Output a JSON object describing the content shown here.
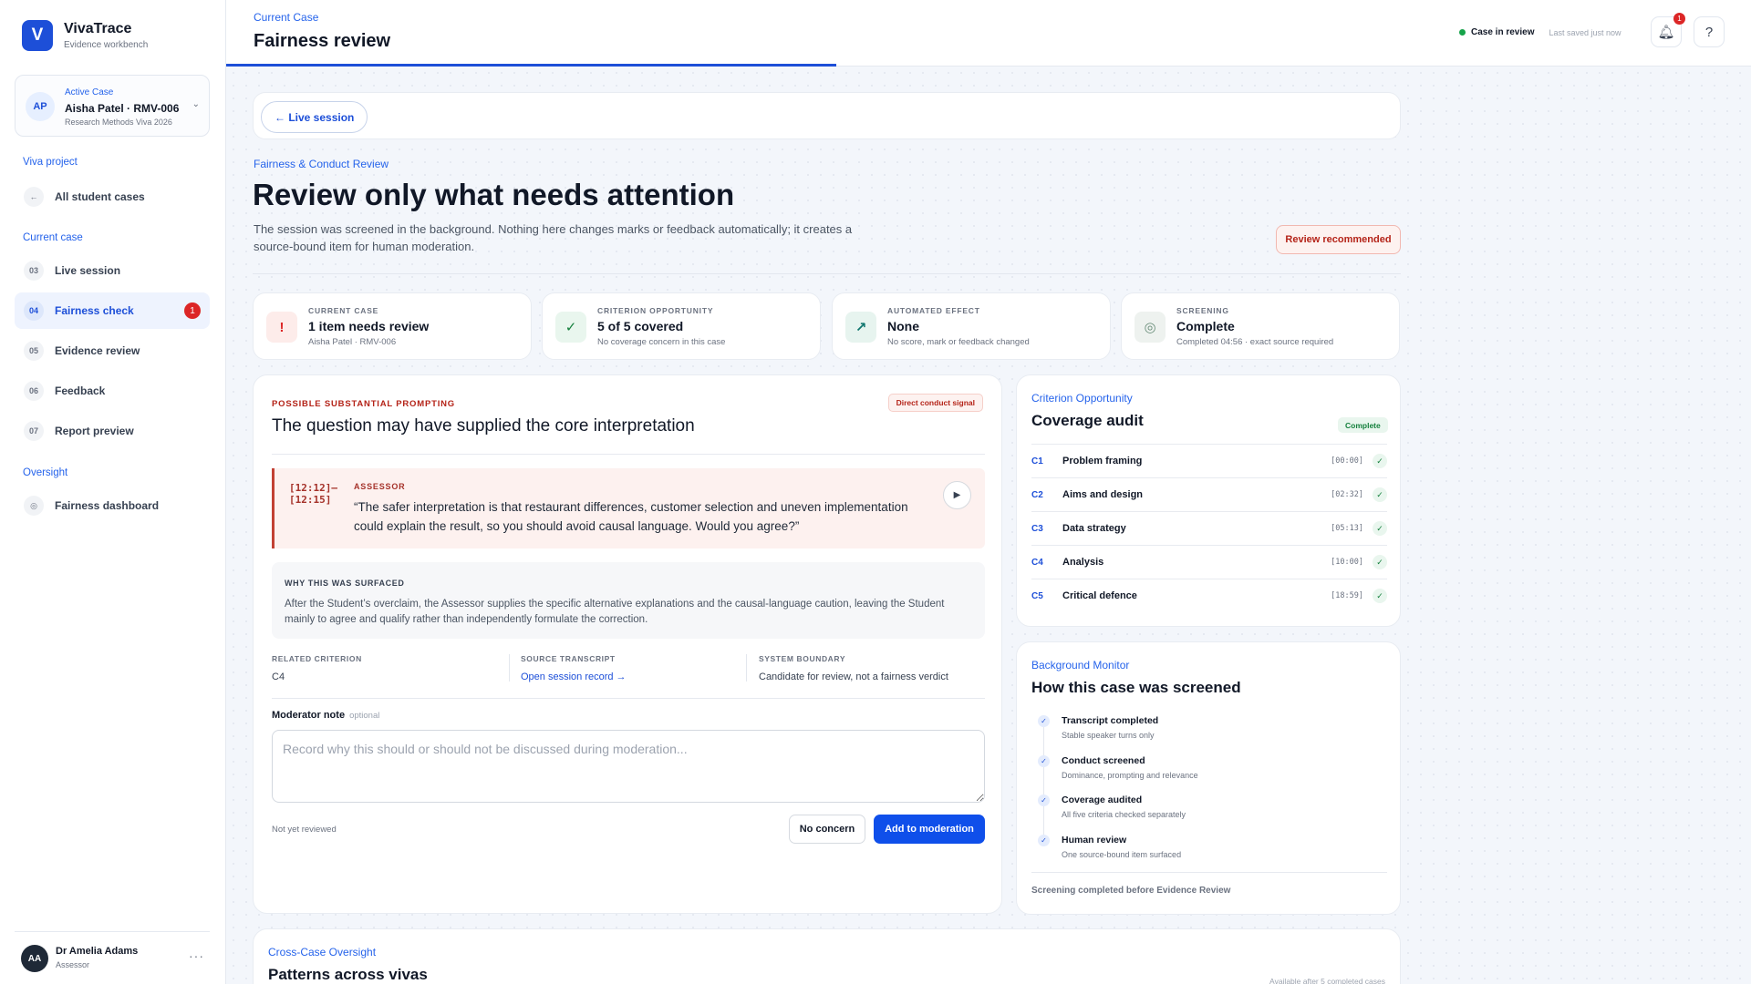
{
  "app": {
    "name": "VivaTrace",
    "subtitle": "Evidence workbench",
    "logo_letter": "V"
  },
  "active_case": {
    "label": "Active Case",
    "initials": "AP",
    "name": "Aisha Patel · RMV-006",
    "sub": "Research Methods Viva 2026"
  },
  "nav": {
    "project_label": "Viva project",
    "all_cases": "All student cases",
    "current_label": "Current case",
    "items": [
      {
        "num": "03",
        "label": "Live session"
      },
      {
        "num": "04",
        "label": "Fairness check",
        "badge": "1"
      },
      {
        "num": "05",
        "label": "Evidence review"
      },
      {
        "num": "06",
        "label": "Feedback"
      },
      {
        "num": "07",
        "label": "Report preview"
      }
    ],
    "oversight_label": "Oversight",
    "dashboard": "Fairness dashboard"
  },
  "user": {
    "initials": "AA",
    "name": "Dr Amelia Adams",
    "role": "Assessor"
  },
  "topbar": {
    "eyebrow": "Current Case",
    "title": "Fairness review",
    "status": "Case in review",
    "saved": "Last saved just now",
    "notif_count": "1",
    "progress": 0.4
  },
  "back_label": "← Live session",
  "page": {
    "eyebrow": "Fairness & Conduct Review",
    "title": "Review only what needs attention",
    "desc": "The session was screened in the background. Nothing here changes marks or feedback automatically; it creates a source-bound item for human moderation.",
    "pill": "Review recommended"
  },
  "stats": [
    {
      "label": "Current Case",
      "value": "1 item needs review",
      "sub": "Aisha Patel · RMV-006",
      "icon": "!"
    },
    {
      "label": "Criterion Opportunity",
      "value": "5 of 5 covered",
      "sub": "No coverage concern in this case",
      "icon": "✓"
    },
    {
      "label": "Automated Effect",
      "value": "None",
      "sub": "No score, mark or feedback changed",
      "icon": "↗"
    },
    {
      "label": "Screening",
      "value": "Complete",
      "sub": "Completed 04:56 · exact source required",
      "icon": "◎"
    }
  ],
  "signal": {
    "eyebrow": "POSSIBLE SUBSTANTIAL PROMPTING",
    "title": "The question may have supplied the core interpretation",
    "tag": "Direct conduct signal",
    "time": "[12:12]–[12:15]",
    "speaker": "ASSESSOR",
    "quote": "“The safer interpretation is that restaurant differences, customer selection and uneven implementation could explain the result, so you should avoid causal language. Would you agree?”",
    "why_label": "WHY THIS WAS SURFACED",
    "why_text": "After the Student’s overclaim, the Assessor supplies the specific alternative explanations and the causal-language caution, leaving the Student mainly to agree and qualify rather than independently formulate the correction.",
    "meta": [
      {
        "label": "RELATED CRITERION",
        "value": "C4"
      },
      {
        "label": "SOURCE TRANSCRIPT",
        "value": "Open session record →"
      },
      {
        "label": "SYSTEM BOUNDARY",
        "value": "Candidate for review, not a fairness verdict"
      }
    ],
    "note_label": "Moderator note",
    "note_optional": "optional",
    "note_placeholder": "Record why this should or should not be discussed during moderation...",
    "note_value": "",
    "reviewed": "Not yet reviewed",
    "btn_no": "No concern",
    "btn_add": "Add to moderation"
  },
  "coverage": {
    "eyebrow": "Criterion Opportunity",
    "title": "Coverage audit",
    "badge": "Complete",
    "rows": [
      {
        "id": "C1",
        "name": "Problem framing",
        "time": "[00:00]"
      },
      {
        "id": "C2",
        "name": "Aims and design",
        "time": "[02:32]"
      },
      {
        "id": "C3",
        "name": "Data strategy",
        "time": "[05:13]"
      },
      {
        "id": "C4",
        "name": "Analysis",
        "time": "[10:00]"
      },
      {
        "id": "C5",
        "name": "Critical defence",
        "time": "[18:59]"
      }
    ]
  },
  "monitor": {
    "eyebrow": "Background Monitor",
    "title": "How this case was screened",
    "steps": [
      {
        "title": "Transcript completed",
        "sub": "Stable speaker turns only"
      },
      {
        "title": "Conduct screened",
        "sub": "Dominance, prompting and relevance"
      },
      {
        "title": "Coverage audited",
        "sub": "All five criteria checked separately"
      },
      {
        "title": "Human review",
        "sub": "One source-bound item surfaced"
      }
    ],
    "footer": "Screening completed before Evidence Review"
  },
  "cross": {
    "eyebrow": "Cross-Case Oversight",
    "title": "Patterns across vivas",
    "note": "Available after 5 completed cases"
  },
  "icons": {
    "back": "arrow-left-icon",
    "chev": "chevron-down-icon",
    "bell": "bell-icon",
    "help": "help-icon",
    "play": "play-icon",
    "check": "check-icon",
    "more": "more-icon",
    "dashboard": "target-icon"
  },
  "colors": {
    "accent": "#1d4fd8",
    "danger": "#dc2626",
    "success": "#15803d"
  }
}
